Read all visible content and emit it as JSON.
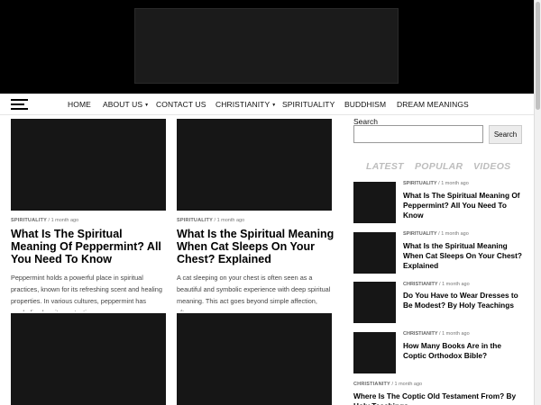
{
  "nav": {
    "items": [
      {
        "label": "HOME",
        "caret": false
      },
      {
        "label": "ABOUT US",
        "caret": true
      },
      {
        "label": "CONTACT US",
        "caret": false
      },
      {
        "label": "CHRISTIANITY",
        "caret": true
      },
      {
        "label": "SPIRITUALITY",
        "caret": false
      },
      {
        "label": "BUDDHISM",
        "caret": false
      },
      {
        "label": "DREAM MEANINGS",
        "caret": false
      }
    ],
    "caret_glyph": "▼"
  },
  "posts": [
    {
      "category": "SPIRITUALITY",
      "sep": "/",
      "time": "1 month ago",
      "title": "What Is The Spiritual Meaning Of Peppermint? All You Need To Know",
      "excerpt": "Peppermint holds a powerful place in spiritual practices, known for its refreshing scent and healing properties. In various cultures, peppermint has symbolized purity, protection,"
    },
    {
      "category": "SPIRITUALITY",
      "sep": "/",
      "time": "1 month ago",
      "title": "What Is the Spiritual Meaning When Cat Sleeps On Your Chest? Explained",
      "excerpt": "A cat sleeping on your chest is often seen as a beautiful and symbolic experience with deep spiritual meaning. This act goes beyond simple affection, often..."
    }
  ],
  "sidebar": {
    "search_label": "Search",
    "search_value": "",
    "search_button": "Search",
    "tabs": [
      "LATEST",
      "POPULAR",
      "VIDEOS"
    ],
    "items": [
      {
        "category": "SPIRITUALITY",
        "sep": "/",
        "time": "1 month ago",
        "title": "What Is The Spiritual Meaning Of Peppermint? All You Need To Know"
      },
      {
        "category": "SPIRITUALITY",
        "sep": "/",
        "time": "1 month ago",
        "title": "What Is the Spiritual Meaning When Cat Sleeps On Your Chest? Explained"
      },
      {
        "category": "CHRISTIANITY",
        "sep": "/",
        "time": "1 month ago",
        "title": "Do You Have to Wear Dresses to Be Modest? By Holy Teachings"
      },
      {
        "category": "CHRISTIANITY",
        "sep": "/",
        "time": "1 month ago",
        "title": "How Many Books Are in the Coptic Orthodox Bible?"
      },
      {
        "category": "CHRISTIANITY",
        "sep": "/",
        "time": "1 month ago",
        "title": "Where Is The Coptic Old Testament From? By Holy Teachings"
      }
    ]
  },
  "colors": {
    "header_bg": "#000000",
    "image_placeholder": "#161616",
    "tab_inactive": "#bdbdbd"
  }
}
